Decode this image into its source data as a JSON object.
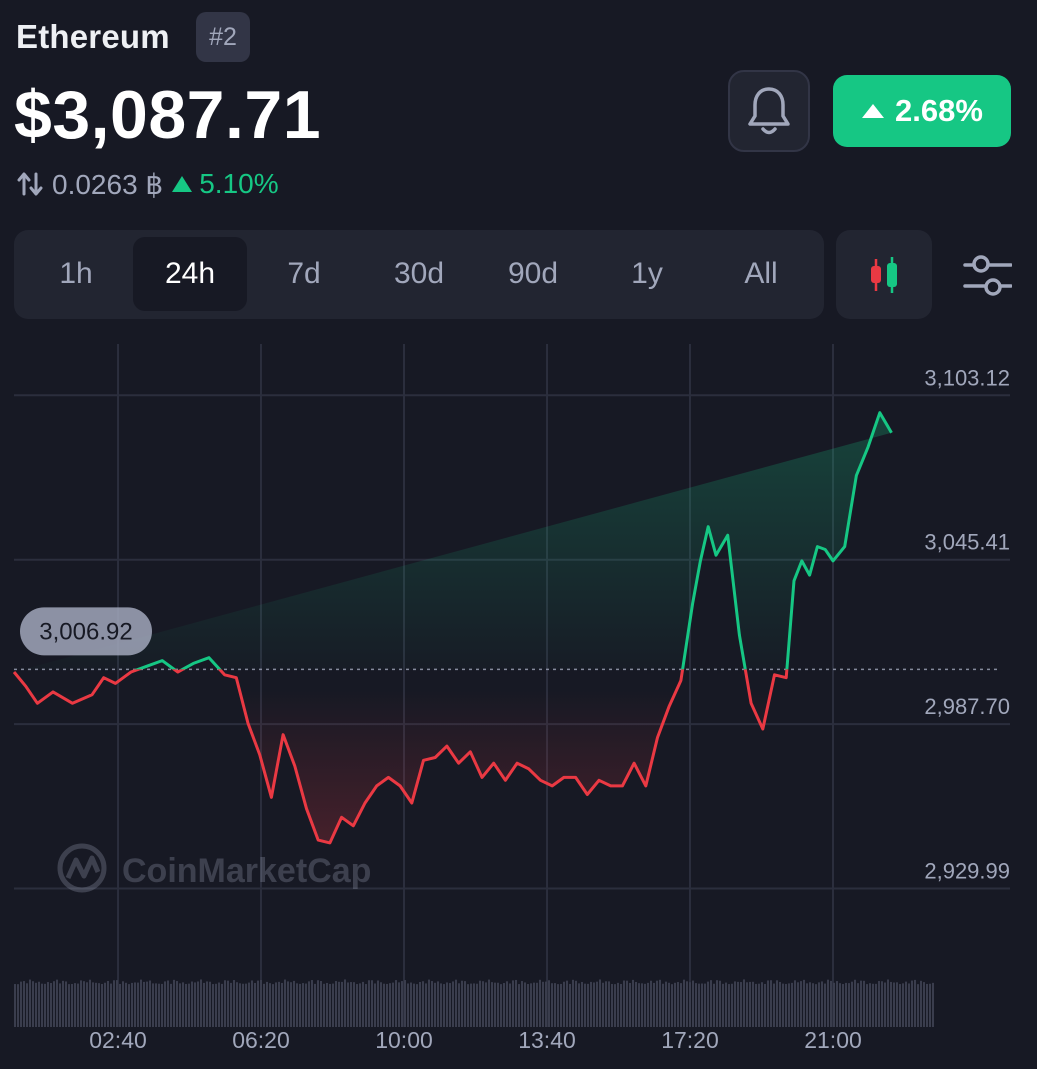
{
  "header": {
    "coin_name": "Ethereum",
    "rank": "#2",
    "price": "$3,087.71",
    "btc_price": "0.0263 ฿",
    "btc_change": "5.10%",
    "change_24h": "2.68%",
    "colors": {
      "up": "#16c784",
      "down": "#ea3943",
      "background": "#171924",
      "panel": "#222531",
      "muted": "#a1a7bb"
    }
  },
  "icons": {
    "swap": "up-down-arrows-icon",
    "bell": "bell-icon",
    "candles": "candlestick-icon",
    "settings": "sliders-icon",
    "caret_up": "caret-up-icon"
  },
  "range_tabs": [
    {
      "label": "1h",
      "active": false
    },
    {
      "label": "24h",
      "active": true
    },
    {
      "label": "7d",
      "active": false
    },
    {
      "label": "30d",
      "active": false
    },
    {
      "label": "90d",
      "active": false
    },
    {
      "label": "1y",
      "active": false
    },
    {
      "label": "All",
      "active": false
    }
  ],
  "chart_data": {
    "type": "line",
    "watermark": "CoinMarketCap",
    "reference_price": 3006.92,
    "reference_label": "3,006.92",
    "y_ticks": [
      "3,103.12",
      "3,045.41",
      "2,987.70",
      "2,929.99"
    ],
    "y_tick_values": [
      3103.12,
      3045.41,
      2987.7,
      2929.99
    ],
    "x_ticks": [
      "02:40",
      "06:20",
      "10:00",
      "13:40",
      "17:20",
      "21:00"
    ],
    "x_tick_hours": [
      2.667,
      6.333,
      10.0,
      13.667,
      17.333,
      21.0
    ],
    "ylim": [
      2920,
      3112
    ],
    "grid": true,
    "price_series": {
      "hours": [
        0.0,
        0.3,
        0.6,
        1.0,
        1.5,
        2.0,
        2.3,
        2.6,
        3.0,
        3.4,
        3.8,
        4.2,
        4.6,
        5.0,
        5.4,
        5.7,
        6.0,
        6.3,
        6.6,
        6.9,
        7.2,
        7.5,
        7.8,
        8.1,
        8.4,
        8.7,
        9.0,
        9.3,
        9.6,
        9.9,
        10.2,
        10.5,
        10.8,
        11.1,
        11.4,
        11.7,
        12.0,
        12.3,
        12.6,
        12.9,
        13.2,
        13.5,
        13.8,
        14.1,
        14.4,
        14.7,
        15.0,
        15.3,
        15.6,
        15.9,
        16.2,
        16.5,
        16.8,
        17.1,
        17.4,
        17.6,
        17.8,
        18.0,
        18.3,
        18.6,
        18.9,
        19.2,
        19.5,
        19.8,
        20.0,
        20.2,
        20.4,
        20.6,
        20.8,
        21.0,
        21.3,
        21.6,
        21.9,
        22.2,
        22.5,
        22.8,
        23.1,
        23.4,
        23.6
      ],
      "values": [
        3006,
        3001,
        2995,
        2999,
        2995,
        2998,
        3004,
        3002,
        3006,
        3008,
        3010,
        3006,
        3009,
        3011,
        3005,
        3004,
        2988,
        2977,
        2962,
        2984,
        2973,
        2958,
        2947,
        2946,
        2955,
        2952,
        2960,
        2966,
        2969,
        2966,
        2960,
        2975,
        2976,
        2980,
        2974,
        2978,
        2969,
        2974,
        2968,
        2974,
        2972,
        2968,
        2966,
        2969,
        2969,
        2963,
        2968,
        2966,
        2966,
        2974,
        2966,
        2983,
        2994,
        3003,
        3030,
        3045,
        3057,
        3047,
        3054,
        3019,
        2995,
        2986,
        3005,
        3004,
        3038,
        3045,
        3040,
        3050,
        3049,
        3045,
        3050,
        3075,
        3085,
        3097,
        3090
      ]
    },
    "volume": {
      "hours": [
        0,
        23.6
      ],
      "relative_levels": [
        0.85,
        0.85
      ]
    }
  }
}
